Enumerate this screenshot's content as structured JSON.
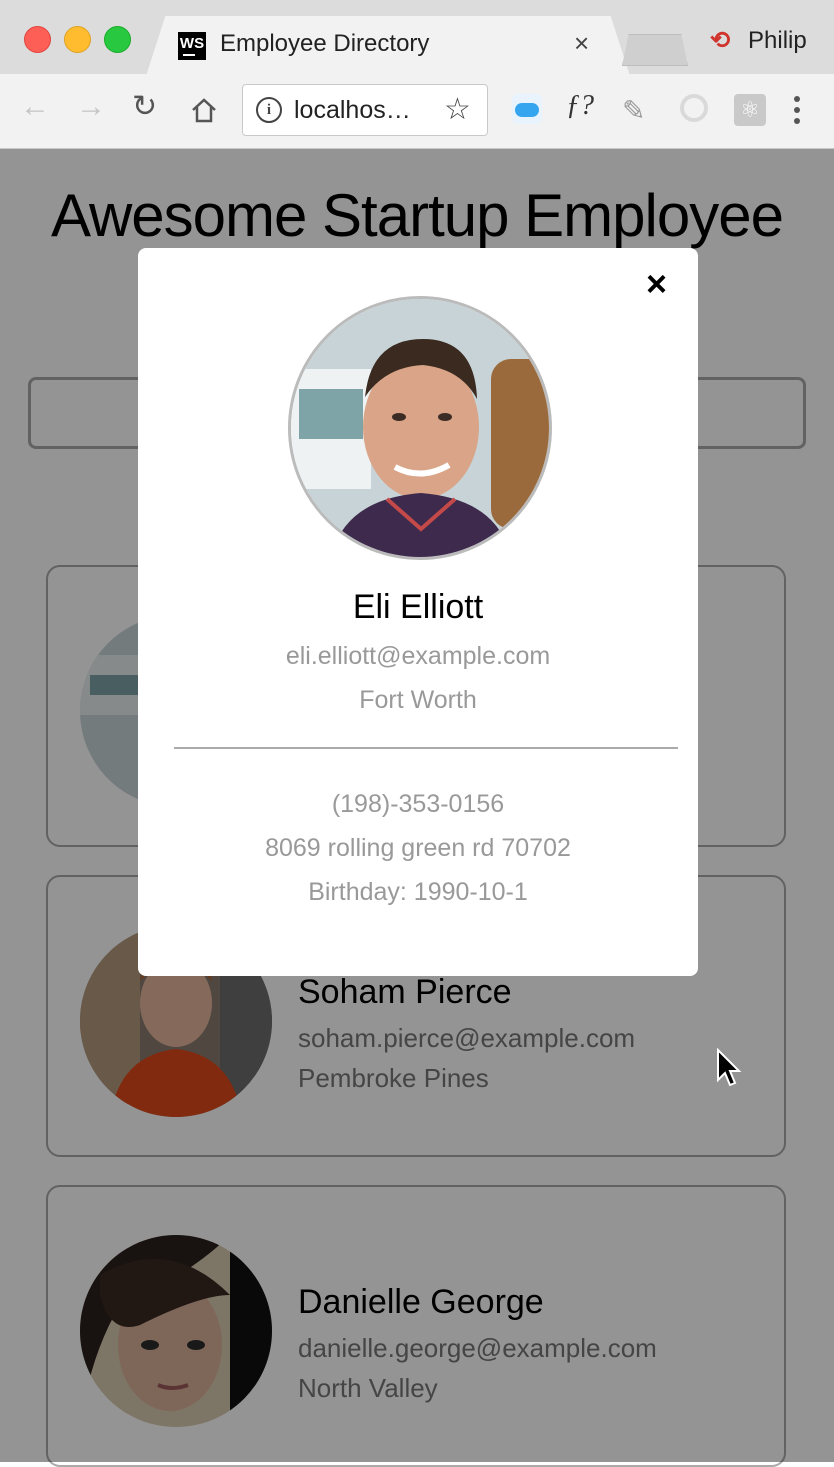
{
  "browser": {
    "tab_title": "Employee Directory",
    "tab_favicon_text": "WS",
    "tab_close": "×",
    "profile_name": "Philip",
    "url": "localhos…"
  },
  "page": {
    "title": "Awesome Startup Employee",
    "employees": [
      {
        "name": "",
        "email": "",
        "city": ""
      },
      {
        "name": "Soham Pierce",
        "email": "soham.pierce@example.com",
        "city": "Pembroke Pines"
      },
      {
        "name": "Danielle George",
        "email": "danielle.george@example.com",
        "city": "North Valley"
      }
    ]
  },
  "modal": {
    "close_label": "×",
    "name": "Eli Elliott",
    "email": "eli.elliott@example.com",
    "city": "Fort Worth",
    "phone": "(198)-353-0156",
    "address": "8069 rolling green rd 70702",
    "birthday": "Birthday: 1990-10-1"
  }
}
